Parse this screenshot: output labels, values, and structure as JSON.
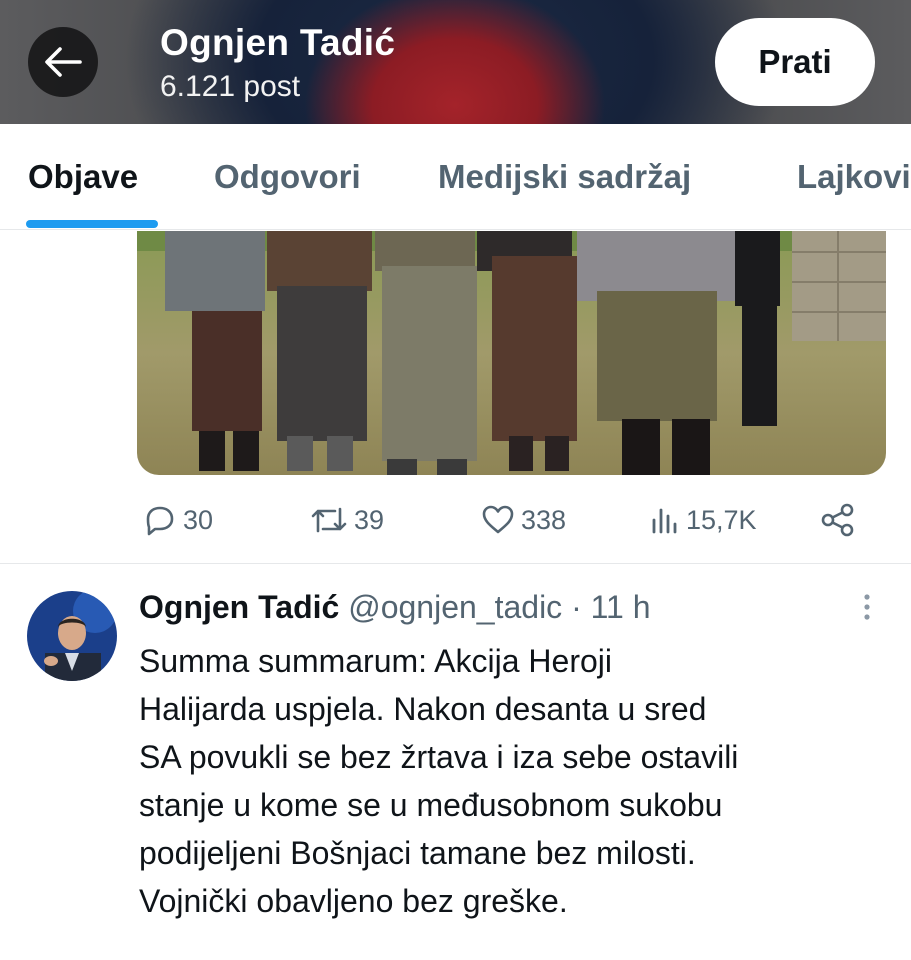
{
  "header": {
    "name": "Ognjen Tadić",
    "post_count": "6.121 post",
    "follow_label": "Prati"
  },
  "tabs": [
    {
      "label": "Objave",
      "active": true
    },
    {
      "label": "Odgovori",
      "active": false
    },
    {
      "label": "Medijski sadržaj",
      "active": false
    },
    {
      "label": "Lajkovi",
      "active": false
    }
  ],
  "media": {
    "description_icon": "photo"
  },
  "actions": {
    "replies": "30",
    "reposts": "39",
    "likes": "338",
    "views": "15,7K"
  },
  "post": {
    "author_name": "Ognjen Tadić",
    "handle": "@ognjen_tadic",
    "separator": "·",
    "time": "11 h",
    "text_lines": [
      "Summa summarum: Akcija Heroji",
      "Halijarda uspjela. Nakon desanta u sred",
      "SA povukli se bez žrtava i iza sebe ostavili",
      "stanje u kome se u međusobnom sukobu",
      "podijeljeni Bošnjaci tamane bez milosti.",
      "Vojnički obavljeno bez greške."
    ]
  },
  "colors": {
    "accent": "#1d9bf0",
    "text_primary": "#0f1419",
    "text_secondary": "#536471"
  }
}
